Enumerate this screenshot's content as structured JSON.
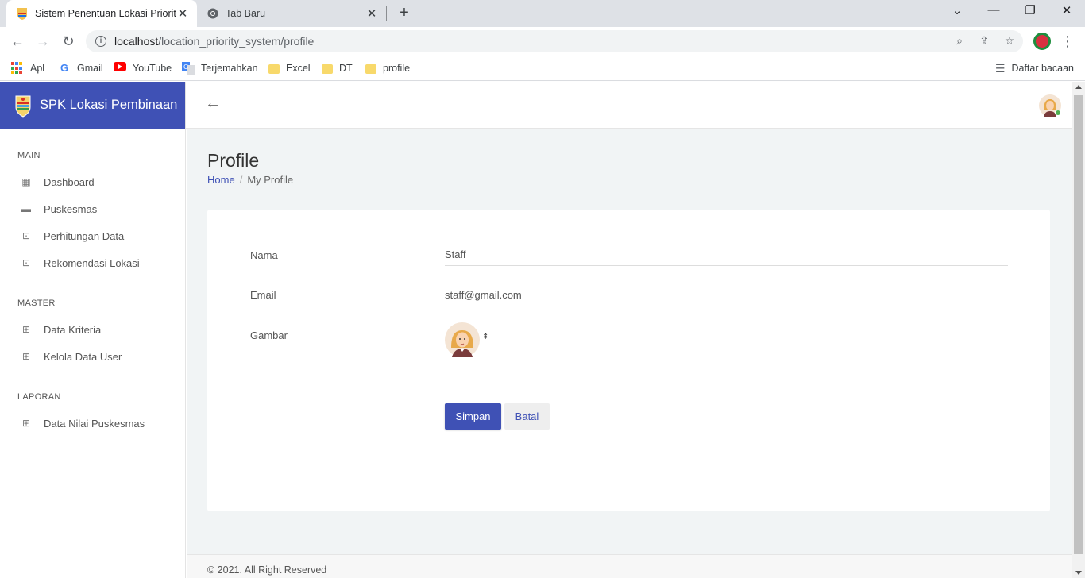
{
  "browser": {
    "tabs": [
      {
        "title": "Sistem Penentuan Lokasi Priorita",
        "active": true
      },
      {
        "title": "Tab Baru",
        "active": false
      }
    ],
    "url_host": "localhost",
    "url_path": "/location_priority_system/profile",
    "bookmarks": [
      "Apl",
      "Gmail",
      "YouTube",
      "Terjemahkan",
      "Excel",
      "DT",
      "profile"
    ],
    "reading_list": "Daftar bacaan"
  },
  "sidebar": {
    "brand": "SPK Lokasi Pembinaan",
    "sections": [
      {
        "title": "MAIN",
        "items": [
          "Dashboard",
          "Puskesmas",
          "Perhitungan Data",
          "Rekomendasi Lokasi"
        ]
      },
      {
        "title": "MASTER",
        "items": [
          "Data Kriteria",
          "Kelola Data User"
        ]
      },
      {
        "title": "LAPORAN",
        "items": [
          "Data Nilai Puskesmas"
        ]
      }
    ]
  },
  "page": {
    "title": "Profile",
    "breadcrumb_home": "Home",
    "breadcrumb_current": "My Profile"
  },
  "form": {
    "name_label": "Nama",
    "name_value": "Staff",
    "email_label": "Email",
    "email_value": "staff@gmail.com",
    "image_label": "Gambar",
    "save_label": "Simpan",
    "cancel_label": "Batal"
  },
  "footer": "© 2021. All Right Reserved",
  "colors": {
    "primary": "#3f51b5",
    "background": "#f1f4f5"
  }
}
